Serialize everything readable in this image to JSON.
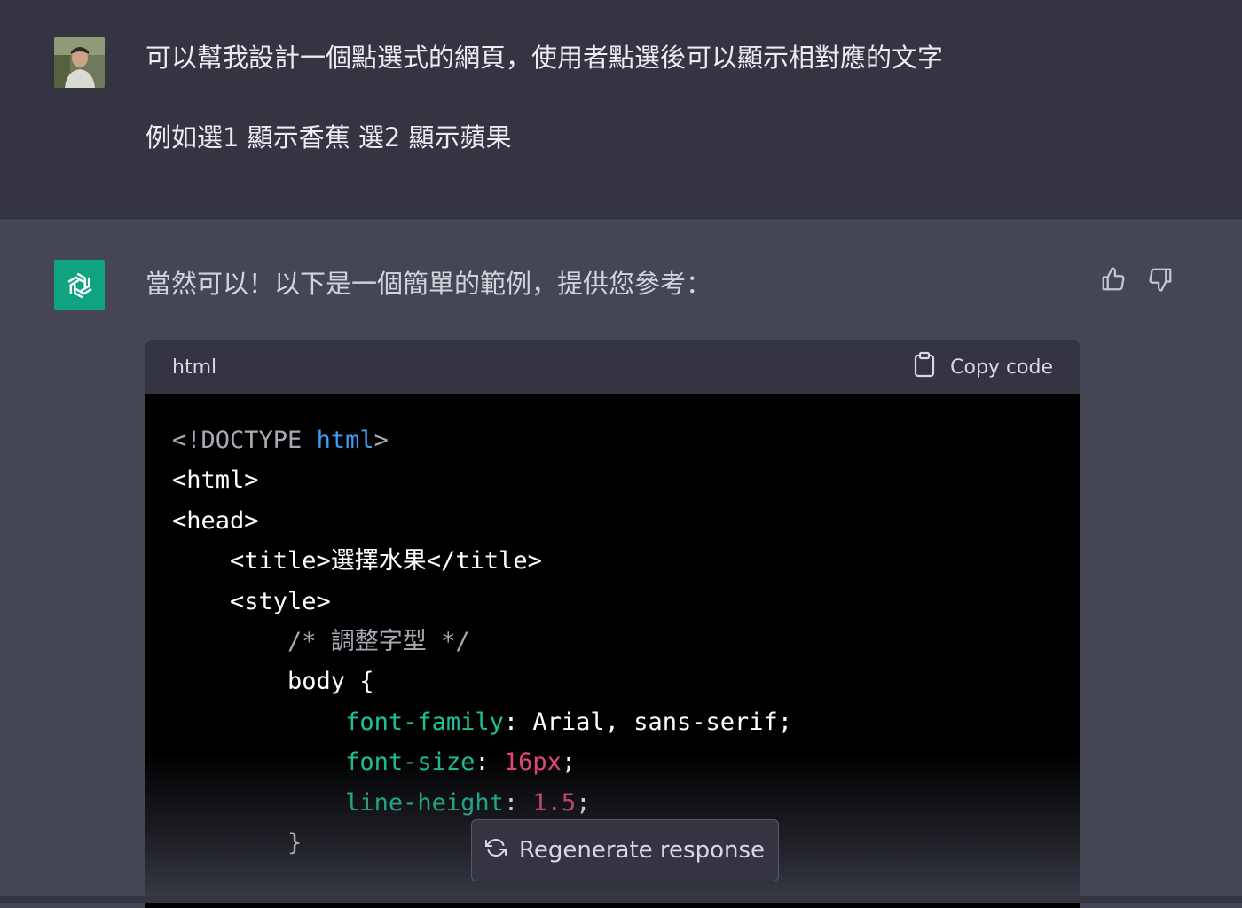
{
  "user_message": {
    "line1": "可以幫我設計一個點選式的網頁，使用者點選後可以顯示相對應的文字",
    "line2": "例如選1 顯示香蕉 選2 顯示蘋果"
  },
  "assistant_message": {
    "intro": "當然可以！以下是一個簡單的範例，提供您參考："
  },
  "code_block": {
    "language": "html",
    "copy_label": "Copy code",
    "lines": [
      [
        {
          "t": "<!DOCTYPE ",
          "c": "gray"
        },
        {
          "t": "html",
          "c": "blue"
        },
        {
          "t": ">",
          "c": "gray"
        }
      ],
      [
        {
          "t": "<html>",
          "c": "white"
        }
      ],
      [
        {
          "t": "<head>",
          "c": "white"
        }
      ],
      [
        {
          "t": "    <title>選擇水果</title>",
          "c": "white"
        }
      ],
      [
        {
          "t": "    <style>",
          "c": "white"
        }
      ],
      [
        {
          "t": "        /* 調整字型 */",
          "c": "gray"
        }
      ],
      [
        {
          "t": "        body {",
          "c": "white"
        }
      ],
      [
        {
          "t": "            ",
          "c": "white"
        },
        {
          "t": "font-family",
          "c": "green"
        },
        {
          "t": ": Arial, sans-serif;",
          "c": "white"
        }
      ],
      [
        {
          "t": "            ",
          "c": "white"
        },
        {
          "t": "font-size",
          "c": "green"
        },
        {
          "t": ": ",
          "c": "white"
        },
        {
          "t": "16px",
          "c": "pink"
        },
        {
          "t": ";",
          "c": "white"
        }
      ],
      [
        {
          "t": "            ",
          "c": "white"
        },
        {
          "t": "line-height",
          "c": "green"
        },
        {
          "t": ": ",
          "c": "white"
        },
        {
          "t": "1.5",
          "c": "pink"
        },
        {
          "t": ";",
          "c": "white"
        }
      ],
      [
        {
          "t": "        }",
          "c": "white"
        }
      ]
    ]
  },
  "regenerate": {
    "label": "Regenerate response"
  },
  "icons": {
    "user_avatar": "user-avatar-photo",
    "bot_avatar": "openai-logo-icon",
    "feedback": [
      "thumbs-up-icon",
      "thumbs-down-icon"
    ],
    "copy": "clipboard-icon",
    "regenerate": "refresh-icon"
  },
  "colors": {
    "user_bg": "#343541",
    "assistant_bg": "#444654",
    "brand": "#10a37f",
    "code_bg": "#000000",
    "code_header_bg": "#343541"
  }
}
